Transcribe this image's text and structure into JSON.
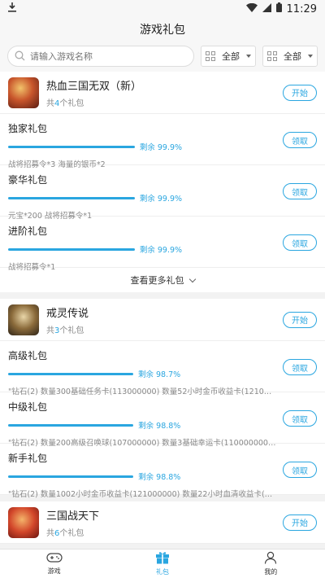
{
  "status": {
    "time": "11:29"
  },
  "header": {
    "title": "游戏礼包"
  },
  "filters": {
    "search_placeholder": "请输入游戏名称",
    "select1": "全部",
    "select2": "全部"
  },
  "games": [
    {
      "title": "热血三国无双（新）",
      "count_prefix": "共",
      "count": "4",
      "count_suffix": "个礼包",
      "start_label": "开始",
      "packs": [
        {
          "name": "独家礼包",
          "remain": "剩余 99.9%",
          "remain_fraction": 0.999,
          "desc": "战将招募令*3 海量的银币*2",
          "claim": "领取"
        },
        {
          "name": "豪华礼包",
          "remain": "剩余 99.9%",
          "remain_fraction": 0.999,
          "desc": "元宝*200 战将招募令*1",
          "claim": "领取"
        },
        {
          "name": "进阶礼包",
          "remain": "剩余 99.9%",
          "remain_fraction": 0.999,
          "desc": "战将招募令*1",
          "claim": "领取"
        }
      ],
      "more_label": "查看更多礼包"
    },
    {
      "title": "戒灵传说",
      "count_prefix": "共",
      "count": "3",
      "count_suffix": "个礼包",
      "start_label": "开始",
      "packs": [
        {
          "name": "高级礼包",
          "remain": "剩余 98.7%",
          "remain_fraction": 0.987,
          "desc": "\"钻石(2) 数量300基础任务卡(113000000) 数量52小时金币收益卡(121000000...",
          "claim": "领取"
        },
        {
          "name": "中级礼包",
          "remain": "剩余 98.8%",
          "remain_fraction": 0.988,
          "desc": "\"钻石(2) 数量200高级召唤球(107000000) 数量3基础幸运卡(110000000) 数...",
          "claim": "领取"
        },
        {
          "name": "新手礼包",
          "remain": "剩余 98.8%",
          "remain_fraction": 0.988,
          "desc": "\"钻石(2) 数量1002小时金币收益卡(121000000) 数量22小时血清收益卡(1210...",
          "claim": "领取"
        }
      ]
    },
    {
      "title": "三国战天下",
      "count_prefix": "共",
      "count": "6",
      "count_suffix": "个礼包",
      "start_label": "开始"
    }
  ],
  "tabs": [
    {
      "label": "游戏",
      "icon": "gamepad-icon"
    },
    {
      "label": "礼包",
      "icon": "gift-icon",
      "active": true
    },
    {
      "label": "我的",
      "icon": "user-icon"
    }
  ],
  "colors": {
    "accent": "#2aa6e0"
  }
}
